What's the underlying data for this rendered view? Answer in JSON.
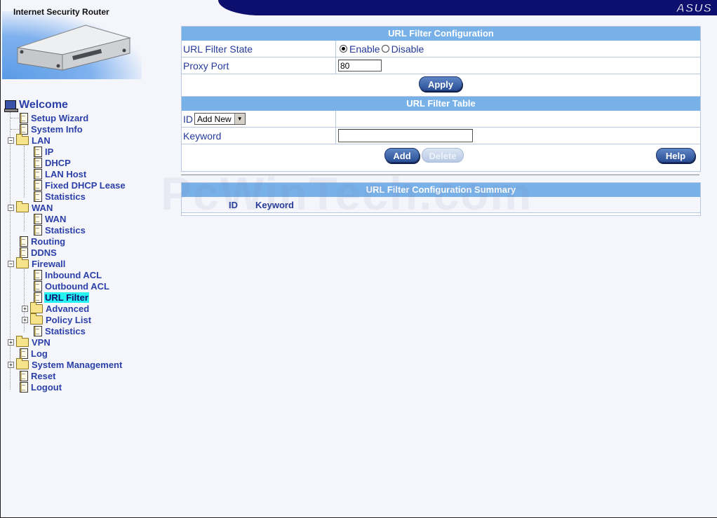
{
  "header": {
    "brand_logo": "ASUS",
    "product_title": "Internet Security Router"
  },
  "sidebar": {
    "welcome": "Welcome",
    "items": [
      {
        "label": "Setup Wizard"
      },
      {
        "label": "System Info"
      },
      {
        "label": "LAN"
      },
      {
        "label": "IP"
      },
      {
        "label": "DHCP"
      },
      {
        "label": "LAN Host"
      },
      {
        "label": "Fixed DHCP Lease"
      },
      {
        "label": "Statistics"
      },
      {
        "label": "WAN"
      },
      {
        "label": "WAN"
      },
      {
        "label": "Statistics"
      },
      {
        "label": "Routing"
      },
      {
        "label": "DDNS"
      },
      {
        "label": "Firewall"
      },
      {
        "label": "Inbound ACL"
      },
      {
        "label": "Outbound ACL"
      },
      {
        "label": "URL Filter"
      },
      {
        "label": "Advanced"
      },
      {
        "label": "Policy List"
      },
      {
        "label": "Statistics"
      },
      {
        "label": "VPN"
      },
      {
        "label": "Log"
      },
      {
        "label": "System Management"
      },
      {
        "label": "Reset"
      },
      {
        "label": "Logout"
      }
    ],
    "selected": "URL Filter"
  },
  "config": {
    "title": "URL Filter Configuration",
    "state_label": "URL Filter State",
    "enable_label": "Enable",
    "disable_label": "Disable",
    "state_value": "Enable",
    "proxy_label": "Proxy Port",
    "proxy_value": "80",
    "apply_label": "Apply"
  },
  "table": {
    "title": "URL Filter Table",
    "id_label": "ID",
    "id_select_value": "Add New",
    "keyword_label": "Keyword",
    "keyword_value": "",
    "add_label": "Add",
    "delete_label": "Delete",
    "help_label": "Help"
  },
  "summary": {
    "title": "URL Filter Configuration Summary",
    "columns": [
      "ID",
      "Keyword"
    ]
  },
  "watermark": "PcWinTech.com",
  "colors": {
    "header_navy": "#0d0f6e",
    "section_header": "#78b0e8",
    "link_blue": "#2b3fa8",
    "selected_highlight": "#27f2f2"
  }
}
